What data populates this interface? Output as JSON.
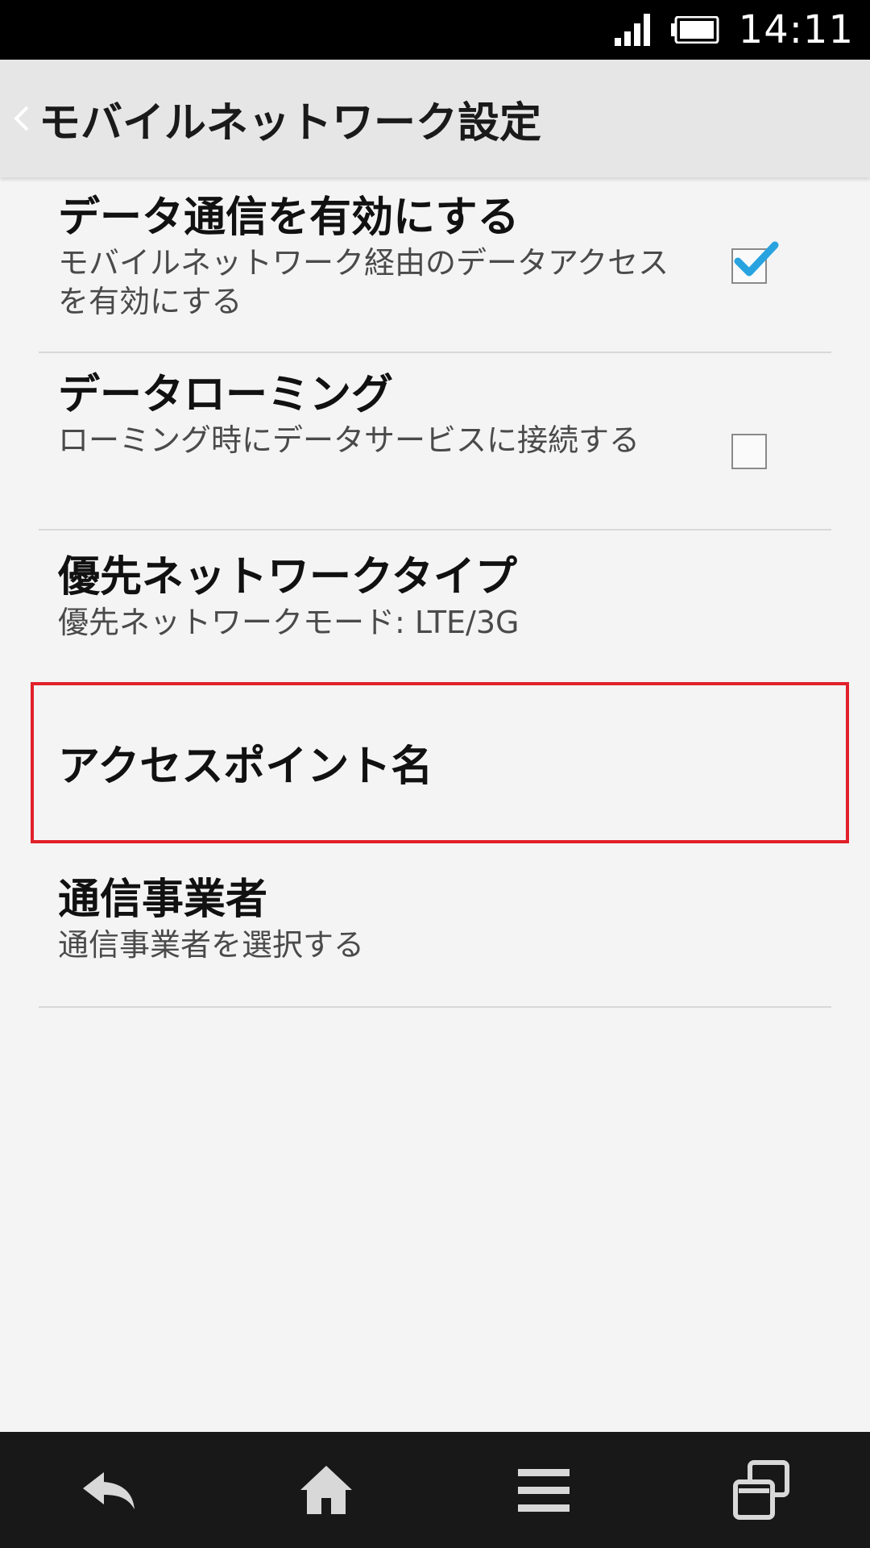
{
  "status_bar": {
    "time": "14:11",
    "icons": [
      "signal-icon",
      "battery-icon"
    ]
  },
  "action_bar": {
    "title": "モバイルネットワーク設定",
    "back_icon": "chevron-left-icon"
  },
  "settings": [
    {
      "title": "データ通信を有効にする",
      "summary": "モバイルネットワーク経由のデータアクセスを有効にする",
      "checkbox": true,
      "checked": true
    },
    {
      "title": "データローミング",
      "summary": "ローミング時にデータサービスに接続する",
      "checkbox": true,
      "checked": false
    },
    {
      "title": "優先ネットワークタイプ",
      "summary": "優先ネットワークモード: LTE/3G"
    },
    {
      "title": "アクセスポイント名",
      "highlighted": true,
      "highlight_color": "#e0202a"
    },
    {
      "title": "通信事業者",
      "summary": "通信事業者を選択する"
    }
  ],
  "colors": {
    "accent_check": "#29a3e0",
    "highlight": "#e0202a",
    "background": "#f4f4f4"
  },
  "nav_bar": {
    "buttons": [
      "back-arrow-icon",
      "home-icon",
      "menu-icon",
      "recent-apps-icon"
    ]
  }
}
